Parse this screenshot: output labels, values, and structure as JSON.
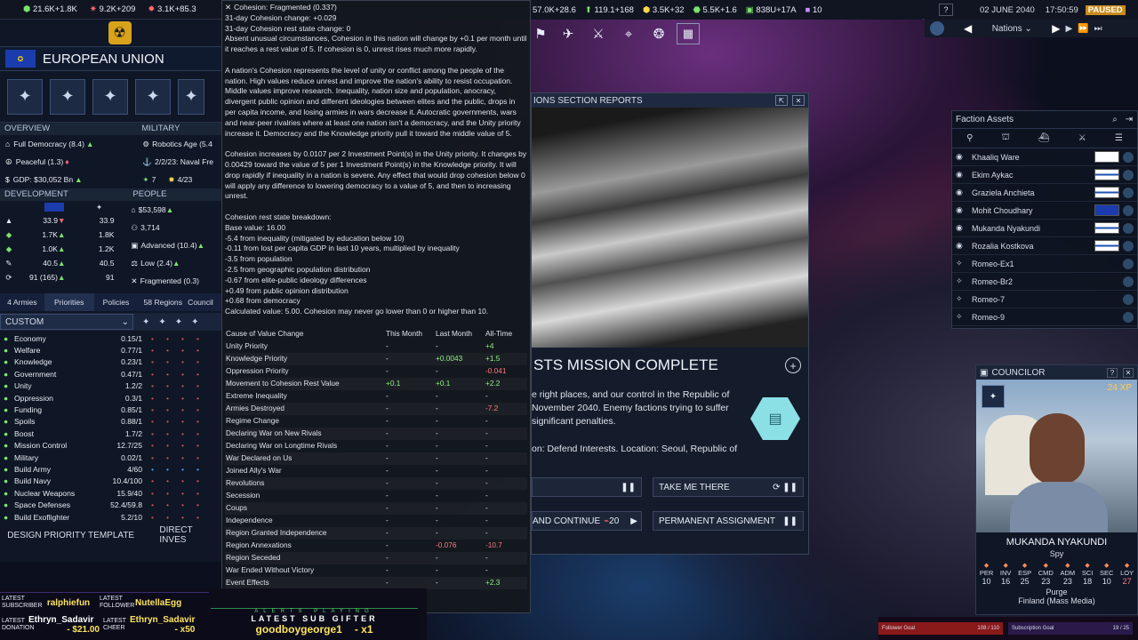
{
  "topbar": {
    "res1": "21.6K+1.8K",
    "res2": "9.2K+209",
    "res3": "3.1K+85.3",
    "res4": "57.0K+28.6",
    "res5": "119.1+168",
    "res6": "3.5K+32",
    "res7": "5.5K+1.6",
    "res8": "838U+17A",
    "res9": "10",
    "date": "02 JUNE 2040",
    "time": "17:50:59",
    "status": "PAUSED",
    "nations_label": "Nations"
  },
  "nation": {
    "name": "EUROPEAN UNION",
    "overview_header": "OVERVIEW",
    "military_header": "MILITARY",
    "overview": [
      "Full Democracy (8.4)",
      "Peaceful (1.3)",
      "GDP: $30,052 Bn"
    ],
    "military": [
      "Robotics Age (5.4",
      "2/2/23: Naval Fre",
      "7",
      "4/23"
    ],
    "development_header": "DEVELOPMENT",
    "people_header": "PEOPLE",
    "development_rows": [
      {
        "a": "33.9",
        "b": "33.9"
      },
      {
        "a": "1.7K",
        "b": "1.8K"
      },
      {
        "a": "1.0K",
        "b": "1.2K"
      },
      {
        "a": "40.5",
        "b": "40.5"
      },
      {
        "a": "91 (165)",
        "b": "91"
      }
    ],
    "people_rows": [
      "$53,598",
      "3,714",
      "Advanced (10.4)",
      "Low (2.4)",
      "Fragmented (0.3)"
    ]
  },
  "priorities": {
    "tabs": [
      "4 Armies",
      "Priorities",
      "Policies",
      "58 Regions",
      "Council"
    ],
    "preset": "CUSTOM",
    "rows": [
      {
        "name": "Economy",
        "val": "0.15/1"
      },
      {
        "name": "Welfare",
        "val": "0.77/1"
      },
      {
        "name": "Knowledge",
        "val": "0.23/1"
      },
      {
        "name": "Government",
        "val": "0.47/1"
      },
      {
        "name": "Unity",
        "val": "1.2/2"
      },
      {
        "name": "Oppression",
        "val": "0.3/1"
      },
      {
        "name": "Funding",
        "val": "0.85/1"
      },
      {
        "name": "Spoils",
        "val": "0.88/1"
      },
      {
        "name": "Boost",
        "val": "1.7/2"
      },
      {
        "name": "Mission Control",
        "val": "12.7/25"
      },
      {
        "name": "Military",
        "val": "0.02/1"
      },
      {
        "name": "Build Army",
        "val": "4/60"
      },
      {
        "name": "Build Navy",
        "val": "10.4/100"
      },
      {
        "name": "Nuclear Weapons",
        "val": "15.9/40"
      },
      {
        "name": "Space Defenses",
        "val": "52.4/59.8"
      },
      {
        "name": "Build Exoflighter",
        "val": "5.2/10"
      }
    ],
    "footer_left": "DESIGN PRIORITY TEMPLATE",
    "footer_right": "DIRECT INVES"
  },
  "tooltip": {
    "title": "Cohesion: Fragmented (0.337)",
    "change": "31-day Cohesion change: +0.029",
    "rest": "31-day Cohesion rest state change: 0",
    "p1": "Absent unusual circumstances, Cohesion in this nation will change by +0.1 per month until it reaches a rest value of 5. If cohesion is 0, unrest rises much more rapidly.",
    "p2": "A nation's Cohesion represents the level of unity or conflict among the people of the nation. High values reduce unrest and improve the nation's ability to resist occupation. Middle values improve research. Inequality, nation size and population, anocracy, divergent public opinion and different ideologies between elites and the public, drops in per capita income, and losing armies in wars decrease it. Autocratic governments, wars and near-peer rivalries where at least one nation isn't a democracy, and the Unity priority increase it. Democracy and the Knowledge priority pull it toward the middle value of 5.",
    "p3": "Cohesion increases by 0.0107 per 2 Investment Point(s) in the Unity priority. It changes by 0.00429 toward the value of 5 per 1 Investment Point(s) in the Knowledge priority. It will drop rapidly if inequality in a nation is severe. Any effect that would drop cohesion below 0 will apply any difference to lowering democracy to a value of 5, and then to increasing unrest.",
    "breakdown_title": "Cohesion rest state breakdown:",
    "breakdown": [
      "Base value: 16.00",
      "-5.4 from inequality (mitigated by education below 10)",
      "-0.11 from lost per capita GDP in last 10 years, multiplied by inequality",
      "-3.5 from population",
      "-2.5 from geographic population distribution",
      "-0.67 from elite-public ideology differences",
      "+0.49 from public opinion distribution",
      "+0.68 from democracy",
      "Calculated value: 5.00. Cohesion may never go lower than 0 or higher than 10."
    ],
    "table_headers": [
      "Cause of Value Change",
      "This Month",
      "Last Month",
      "All-Time"
    ],
    "table_rows": [
      [
        "Unity Priority",
        "-",
        "-",
        "+4"
      ],
      [
        "Knowledge Priority",
        "-",
        "+0.0043",
        "+1.5"
      ],
      [
        "Oppression Priority",
        "-",
        "-",
        "-0.041"
      ],
      [
        "Movement to Cohesion Rest Value",
        "+0.1",
        "+0.1",
        "+2.2"
      ],
      [
        "Extreme Inequality",
        "-",
        "-",
        "-"
      ],
      [
        "Armies Destroyed",
        "-",
        "-",
        "-7.2"
      ],
      [
        "Regime Change",
        "-",
        "-",
        "-"
      ],
      [
        "Declaring War on New Rivals",
        "-",
        "-",
        "-"
      ],
      [
        "Declaring War on Longtime Rivals",
        "-",
        "-",
        "-"
      ],
      [
        "War Declared on Us",
        "-",
        "-",
        "-"
      ],
      [
        "Joined Ally's War",
        "-",
        "-",
        "-"
      ],
      [
        "Revolutions",
        "-",
        "-",
        "-"
      ],
      [
        "Secession",
        "-",
        "-",
        "-"
      ],
      [
        "Coups",
        "-",
        "-",
        "-"
      ],
      [
        "Independence",
        "-",
        "-",
        "-"
      ],
      [
        "Region Granted Independence",
        "-",
        "-",
        "-"
      ],
      [
        "Region Annexations",
        "-",
        "-0.076",
        "-10.7"
      ],
      [
        "Region Seceded",
        "-",
        "-",
        "-"
      ],
      [
        "War Ended Without Victory",
        "-",
        "-",
        "-"
      ],
      [
        "Event Effects",
        "-",
        "-",
        "+2.3"
      ]
    ]
  },
  "report": {
    "header": "IONS SECTION REPORTS",
    "mission_title": "STS MISSION COMPLETE",
    "body": "e right places, and our control in the Republic of November 2040. Enemy factions trying to suffer significant penalties.",
    "location": "on: Defend Interests. Location: Seoul, Republic of",
    "btn_take": "TAKE ME THERE",
    "btn_continue": "AND CONTINUE",
    "continue_count": "20",
    "btn_perm": "PERMANENT ASSIGNMENT"
  },
  "faction_assets": {
    "title": "Faction Assets",
    "items": [
      {
        "name": "Khaaliq Ware",
        "flag": "korea"
      },
      {
        "name": "Ekim Aykac",
        "flag": "finland"
      },
      {
        "name": "Graziela Anchieta",
        "flag": "finland"
      },
      {
        "name": "Mohit Choudhary",
        "flag": "eu"
      },
      {
        "name": "Mukanda Nyakundi",
        "flag": "finland"
      },
      {
        "name": "Rozalia Kostkova",
        "flag": "finland"
      },
      {
        "name": "Romeo-Ex1",
        "flag": "orbit"
      },
      {
        "name": "Romeo-Br2",
        "flag": "orbit"
      },
      {
        "name": "Romeo-7",
        "flag": "orbit"
      },
      {
        "name": "Romeo-9",
        "flag": "orbit"
      }
    ]
  },
  "councilor": {
    "header": "COUNCILOR",
    "xp": "24 XP",
    "name": "MUKANDA NYAKUNDI",
    "role": "Spy",
    "stat_labels": [
      "PER",
      "INV",
      "ESP",
      "CMD",
      "ADM",
      "SCI",
      "SEC",
      "LOY"
    ],
    "stat_values": [
      "10",
      "16",
      "25",
      "23",
      "23",
      "18",
      "10",
      "27"
    ],
    "mission": "Purge",
    "location": "Finland (Mass Media)"
  },
  "stream": {
    "latest_subscriber_label": "LATEST SUBSCRIBER",
    "latest_subscriber": "ralphiefun",
    "latest_follower_label": "LATEST FOLLOWER",
    "latest_follower": "NutellaEgg",
    "latest_donation_label": "LATEST DONATION",
    "donor": "Ethryn_Sadavir",
    "donation": "- $21.00",
    "latest_cheer_label": "LATEST CHEER",
    "cheerer": "Ethryn_Sadavir",
    "cheer": "- x50",
    "alerts_label": "ALERTS PLAYING",
    "gifter_label": "LATEST SUB GIFTER",
    "gifter": "goodboygeorge1",
    "gift_count": "- x1",
    "follower_goal": "Follower Goal",
    "follower_goal_val": "108 / 110",
    "sub_goal": "Subscription Goal",
    "sub_goal_val": "19 / 25"
  }
}
